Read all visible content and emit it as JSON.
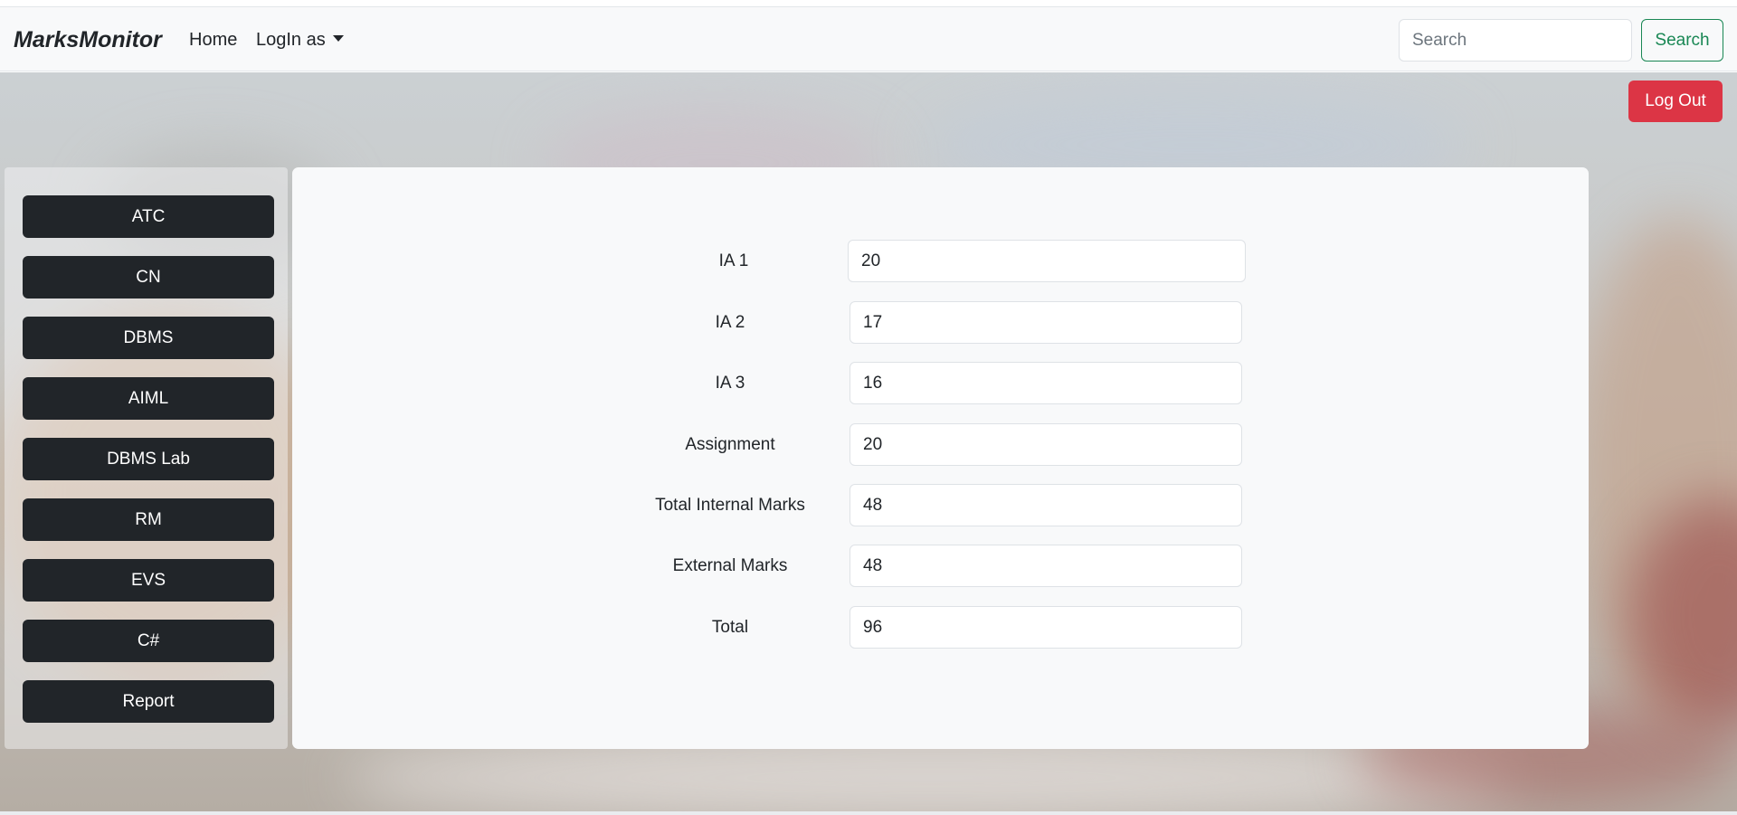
{
  "navbar": {
    "brand": "MarksMonitor",
    "home": "Home",
    "login_as": "LogIn as",
    "search_placeholder": "Search",
    "search_button": "Search"
  },
  "logout_label": "Log Out",
  "sidebar": {
    "items": [
      {
        "label": "ATC"
      },
      {
        "label": "CN"
      },
      {
        "label": "DBMS"
      },
      {
        "label": "AIML"
      },
      {
        "label": "DBMS Lab"
      },
      {
        "label": "RM"
      },
      {
        "label": "EVS"
      },
      {
        "label": "C#"
      },
      {
        "label": "Report"
      }
    ]
  },
  "marks": {
    "rows": [
      {
        "label": "IA 1",
        "value": "20"
      },
      {
        "label": "IA 2",
        "value": "17"
      },
      {
        "label": "IA 3",
        "value": "16"
      },
      {
        "label": "Assignment",
        "value": "20"
      },
      {
        "label": "Total Internal Marks",
        "value": "48"
      },
      {
        "label": "External Marks",
        "value": "48"
      },
      {
        "label": "Total",
        "value": "96"
      }
    ]
  },
  "colors": {
    "primary_dark": "#212529",
    "danger": "#dc3545",
    "success": "#198754",
    "light": "#f8f9fa"
  }
}
